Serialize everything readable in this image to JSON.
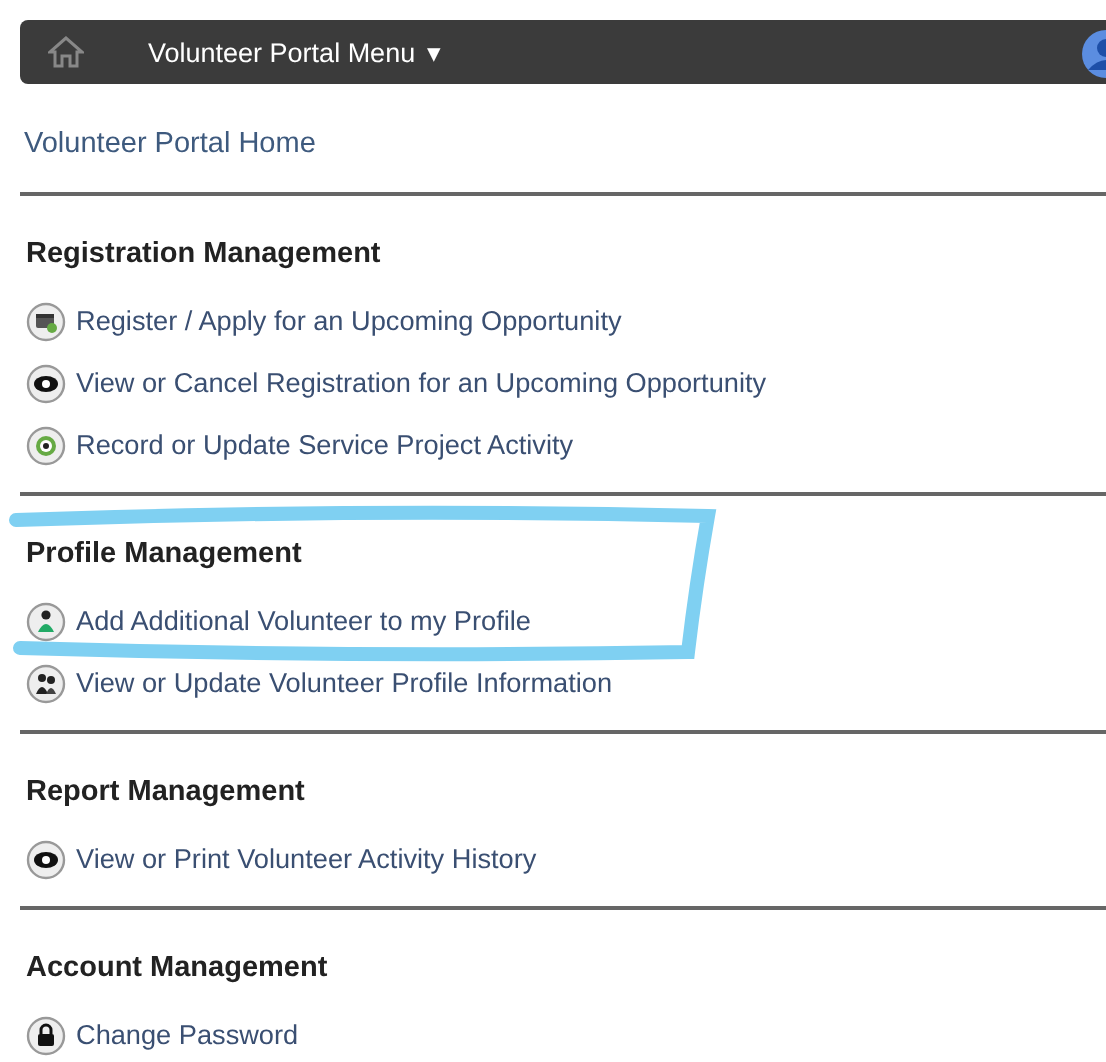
{
  "navbar": {
    "menu_label": "Volunteer Portal Menu",
    "caret": "▾"
  },
  "home_link": "Volunteer Portal Home",
  "sections": [
    {
      "title": "Registration Management",
      "highlighted": false,
      "items": [
        {
          "kind": "calendar",
          "label": "Register / Apply for an Upcoming Opportunity"
        },
        {
          "kind": "eye",
          "label": "View or Cancel Registration for an Upcoming Opportunity"
        },
        {
          "kind": "target",
          "label": "Record or Update Service Project Activity"
        }
      ]
    },
    {
      "title": "Profile Management",
      "highlighted": true,
      "items": [
        {
          "kind": "person",
          "label": "Add Additional Volunteer to my Profile"
        },
        {
          "kind": "group",
          "label": "View or Update Volunteer Profile Information"
        }
      ]
    },
    {
      "title": "Report Management",
      "highlighted": false,
      "items": [
        {
          "kind": "eye",
          "label": "View or Print Volunteer Activity History"
        }
      ]
    },
    {
      "title": "Account Management",
      "highlighted": false,
      "items": [
        {
          "kind": "lock",
          "label": "Change Password"
        }
      ]
    }
  ]
}
